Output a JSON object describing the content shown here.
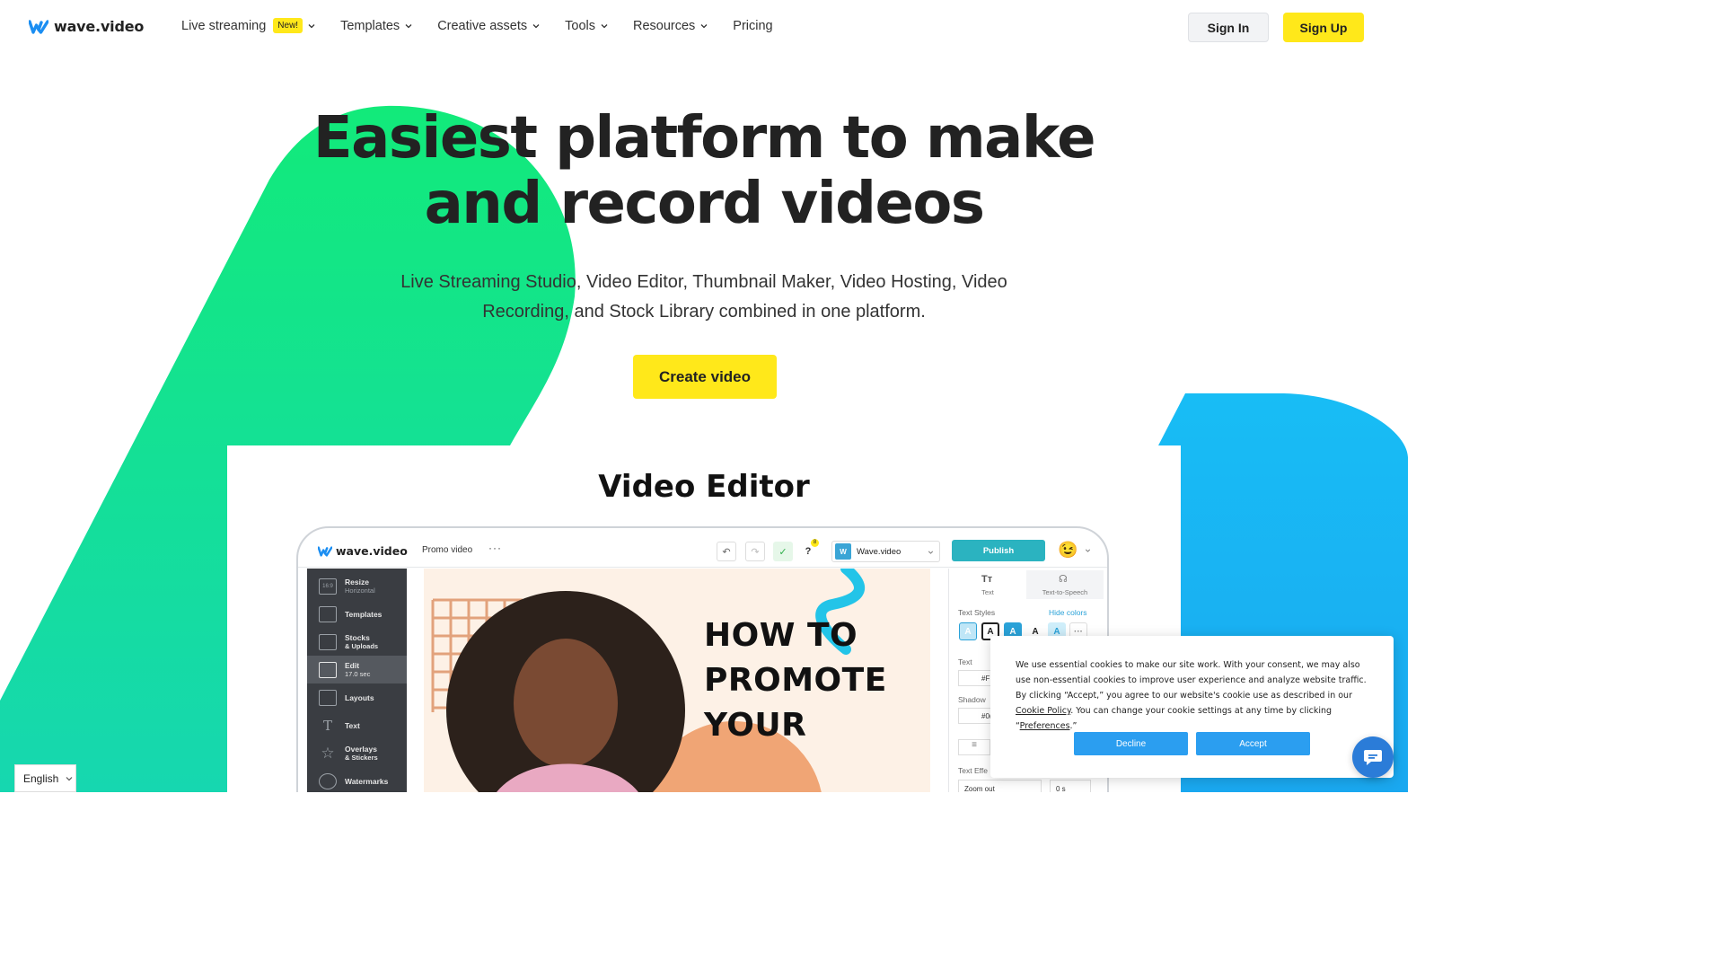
{
  "header": {
    "logo_text": "wave.video",
    "nav": [
      {
        "label": "Live streaming",
        "badge": "New!",
        "has_dropdown": true
      },
      {
        "label": "Templates",
        "has_dropdown": true
      },
      {
        "label": "Creative assets",
        "has_dropdown": true
      },
      {
        "label": "Tools",
        "has_dropdown": true
      },
      {
        "label": "Resources",
        "has_dropdown": true
      },
      {
        "label": "Pricing",
        "has_dropdown": false
      }
    ],
    "sign_in": "Sign In",
    "sign_up": "Sign Up"
  },
  "hero": {
    "title_line1": "Easiest platform to make",
    "title_line2": "and record videos",
    "subtitle_line1": "Live Streaming Studio, Video Editor, Thumbnail Maker, Video Hosting, Video",
    "subtitle_line2": "Recording, and Stock Library combined in one platform.",
    "cta": "Create video"
  },
  "editor_card": {
    "title": "Video Editor",
    "app_logo": "wave.video",
    "project_name": "Promo video",
    "more_dots": "···",
    "notification_count": "8",
    "brand_select": {
      "badge": "W",
      "value": "Wave.video"
    },
    "publish": "Publish",
    "sidebar": [
      {
        "label": "Resize",
        "sub": "Horizontal",
        "icon": "resize-icon"
      },
      {
        "label": "Templates",
        "sub": "",
        "icon": "templates-icon"
      },
      {
        "label": "Stocks",
        "sub": "& Uploads",
        "icon": "image-icon"
      },
      {
        "label": "Edit",
        "sub": "17.0 sec",
        "icon": "clapper-icon",
        "active": true
      },
      {
        "label": "Layouts",
        "sub": "",
        "icon": "layouts-icon"
      },
      {
        "label": "Text",
        "sub": "",
        "icon": "text-icon"
      },
      {
        "label": "Overlays",
        "sub": "& Stickers",
        "icon": "star-icon"
      },
      {
        "label": "Watermarks",
        "sub": "",
        "icon": "watermark-icon"
      }
    ],
    "resize_ratio": "16:9",
    "canvas_text": [
      "HOW TO",
      "PROMOTE",
      "YOUR"
    ],
    "panel": {
      "tab_text": "Text",
      "tab_tts": "Text-to-Speech",
      "text_styles_label": "Text Styles",
      "hide_colors": "Hide colors",
      "text_label": "Text",
      "text_value": "#FI",
      "shadow_label": "Shadow",
      "shadow_value": "#0(",
      "text_effect_label": "Text Effe",
      "effect_value": "Zoom out",
      "duration_value": "0 s"
    }
  },
  "cookie": {
    "text_before": "We use essential cookies to make our site work. With your consent, we may also use non-essential cookies to improve user experience and analyze website traffic. By clicking “Accept,” you agree to our website's cookie use as described in our ",
    "policy_link": "Cookie Policy",
    "text_middle": ". You can change your cookie settings at any time by clicking “",
    "prefs_link": "Preferences",
    "text_after": ".”",
    "decline": "Decline",
    "accept": "Accept"
  },
  "language": "English",
  "colors": {
    "brand_yellow": "#ffe81a",
    "green_shape": "#10e37e",
    "blue_shape": "#16b8f5",
    "publish_teal": "#2bb3c0",
    "cookie_button": "#2b9ef0"
  }
}
